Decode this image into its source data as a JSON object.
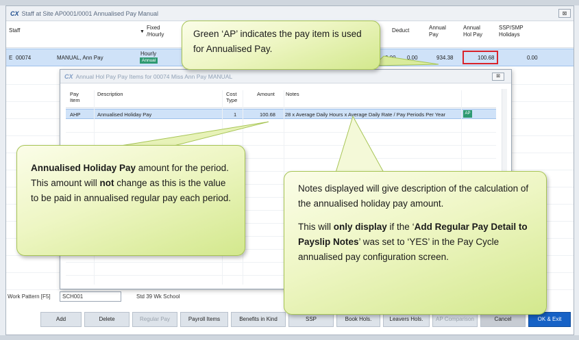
{
  "window": {
    "title": "Staff at Site AP0001/0001 Annualised Pay Manual",
    "close": "⊠"
  },
  "columns": {
    "staff": "Staff",
    "fixed": "Fixed /Hourly",
    "deduct": "Deduct",
    "annual_pay": "Annual Pay",
    "annual_hol_pay": "Annual Hol Pay",
    "ssp_smp": "SSP/SMP Holidays"
  },
  "row": {
    "type": "E",
    "id": "00074",
    "name": "MANUAL, Ann Pay",
    "fixed": "Hourly",
    "badge": "Annual",
    "v1": "0.00",
    "deduct": "0.00",
    "annual_pay": "934.38",
    "annual_hol_pay": "100.68",
    "ssp": "0.00"
  },
  "dialog": {
    "title": "Annual Hol Pay Pay Items for 00074   Miss Ann Pay MANUAL",
    "close": "⊠",
    "headers": {
      "pay_item": "Pay Item",
      "description": "Description",
      "cost_type": "Cost Type",
      "amount": "Amount",
      "notes": "Notes"
    },
    "row": {
      "pay_item": "AHP",
      "description": "Annualised Holiday Pay",
      "cost_type": "1",
      "amount": "100.68",
      "notes": "28 x Average Daily Hours x Average Daily Rate / Pay Periods Per Year",
      "badge": "AP"
    }
  },
  "work_pattern": {
    "label": "Work Pattern [F5]",
    "value": "SCH001",
    "desc": "Std 39 Wk School"
  },
  "buttons": {
    "add": "Add",
    "delete": "Delete",
    "regular_pay": "Regular Pay",
    "payroll_items": "Payroll Items",
    "benefits": "Benefits in Kind",
    "ssp": "SSP",
    "book_hols": "Book Hols.",
    "leavers_hols": "Leavers Hols.",
    "ap_comparison": "AP Comparison",
    "cancel": "Cancel",
    "ok_exit": "OK & Exit"
  },
  "callouts": {
    "c1": "Green ‘AP’ indicates the pay item is used for Annualised Pay.",
    "c2_bold1": "Annualised Holiday Pay",
    "c2_t1": " amount for the period. This amount will ",
    "c2_bold2": "not",
    "c2_t2": " change as this is the value to be paid in annualised regular pay each period.",
    "c3_p1": "Notes displayed will give description of the calculation of the annualised holiday pay amount.",
    "c3_t1": "This will ",
    "c3_bold1": "only display",
    "c3_t2": " if the ‘",
    "c3_bold2": "Add Regular Pay Detail to Payslip Notes",
    "c3_t3": "’ was set to ‘YES’ in the Pay Cycle annualised pay configuration screen."
  },
  "colors": {
    "accent": "#1762c6",
    "ap_green": "#2e9a72",
    "highlight_red": "#d9222a",
    "callout": "#e6f2b0"
  }
}
